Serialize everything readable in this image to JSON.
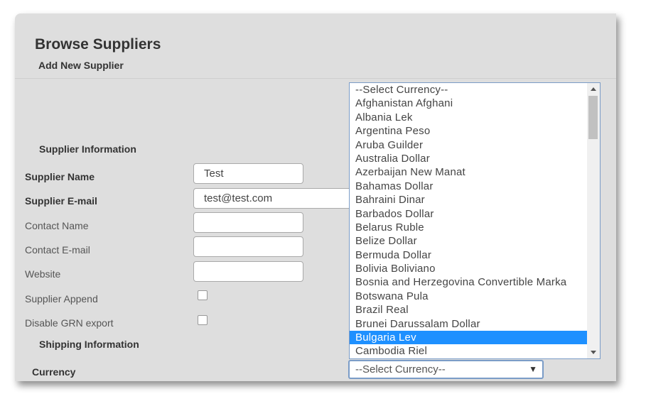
{
  "header": {
    "title": "Browse Suppliers",
    "subtitle": "Add New Supplier"
  },
  "sections": {
    "supplier_info": "Supplier Information",
    "shipping_info": "Shipping Information"
  },
  "form": {
    "supplier_name": {
      "label": "Supplier Name",
      "value": "Test"
    },
    "supplier_email": {
      "label": "Supplier E-mail",
      "value": "test@test.com"
    },
    "contact_name": {
      "label": "Contact Name",
      "value": ""
    },
    "contact_email": {
      "label": "Contact E-mail",
      "value": ""
    },
    "website": {
      "label": "Website",
      "value": ""
    },
    "supplier_append": {
      "label": "Supplier Append",
      "checked": false
    },
    "disable_grn": {
      "label": "Disable GRN export",
      "checked": false
    },
    "currency": {
      "label": "Currency",
      "selected": "--Select Currency--"
    }
  },
  "currency_options": [
    "--Select Currency--",
    "Afghanistan Afghani",
    "Albania Lek",
    "Argentina Peso",
    "Aruba Guilder",
    "Australia Dollar",
    "Azerbaijan New Manat",
    "Bahamas Dollar",
    "Bahraini Dinar",
    "Barbados Dollar",
    "Belarus Ruble",
    "Belize Dollar",
    "Bermuda Dollar",
    "Bolivia Boliviano",
    "Bosnia and Herzegovina Convertible Marka",
    "Botswana Pula",
    "Brazil Real",
    "Brunei Darussalam Dollar",
    "Bulgaria Lev",
    "Cambodia Riel"
  ],
  "highlighted_option": "Bulgaria Lev",
  "colors": {
    "highlight": "#1e90ff",
    "panel": "#dedede",
    "focus_border": "#7a9cc7"
  }
}
